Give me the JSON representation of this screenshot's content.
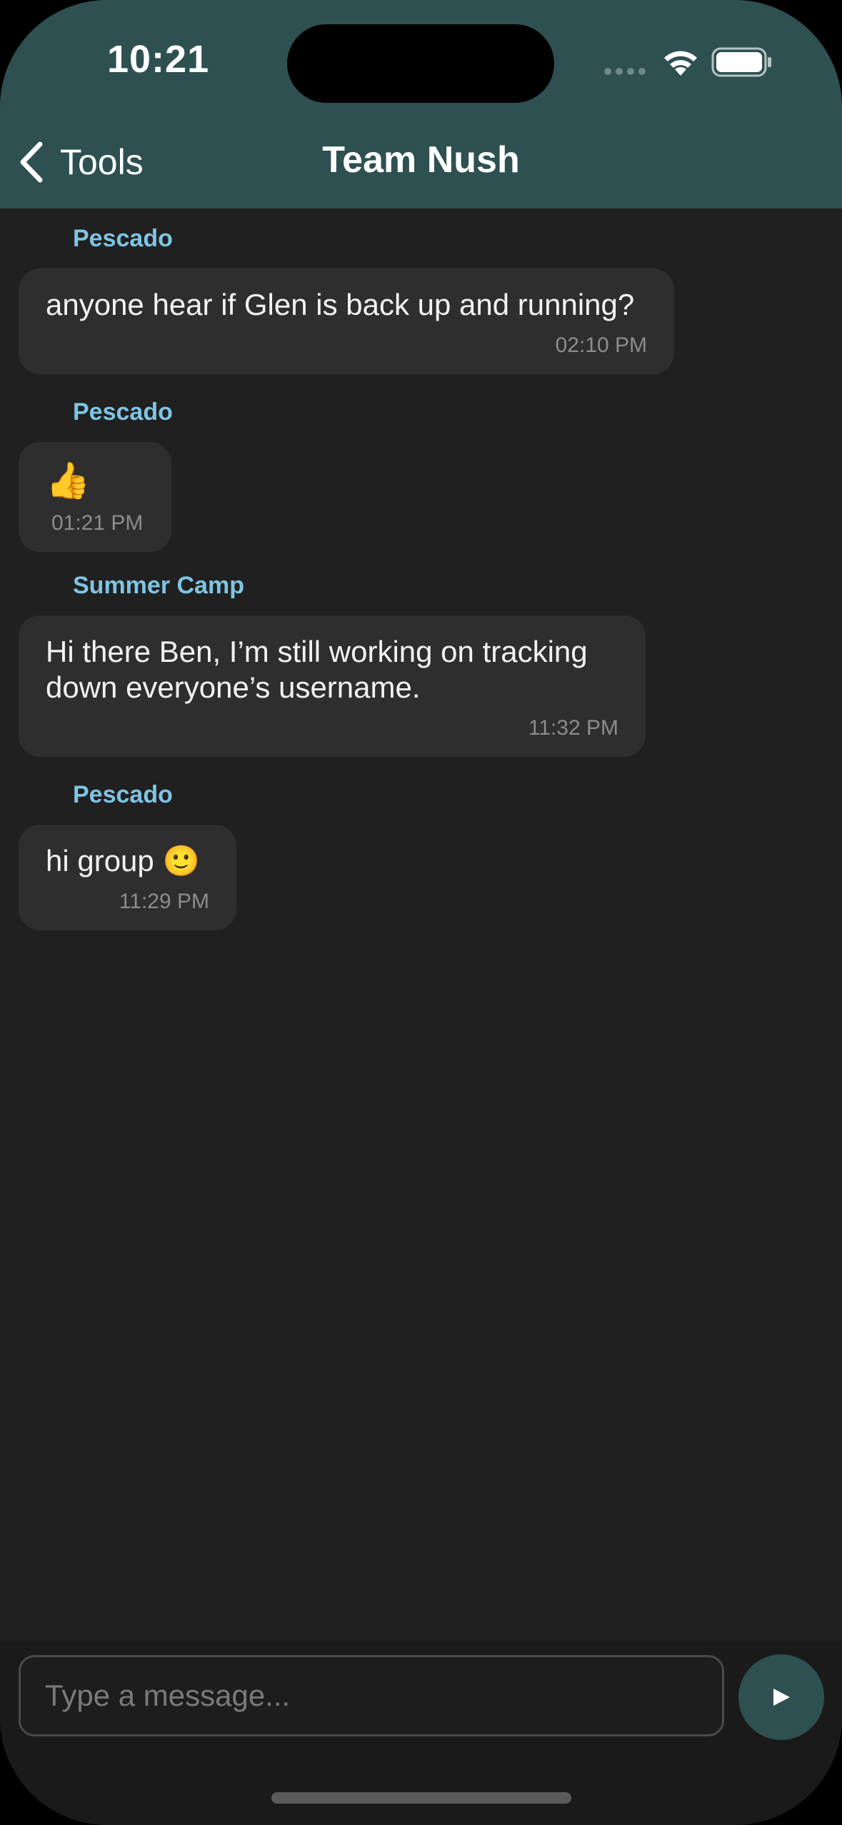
{
  "status": {
    "time": "10:21"
  },
  "nav": {
    "back_label": "Tools",
    "title": "Team Nush"
  },
  "messages": [
    {
      "sender": "Pescado",
      "text": "anyone hear if Glen is back up and running?",
      "time": "02:10 PM"
    },
    {
      "sender": "Pescado",
      "text": "👍",
      "time": "01:21 PM"
    },
    {
      "sender": "Summer Camp",
      "text": "Hi there Ben, I’m still working on tracking\ndown everyone’s username.",
      "time": "11:32 PM"
    },
    {
      "sender": "Pescado",
      "text": "hi group 🙂",
      "time": "11:29 PM"
    }
  ],
  "composer": {
    "placeholder": "Type a message..."
  },
  "colors": {
    "header": "#2e5050",
    "background": "#202020",
    "bubble": "#2e2e2e",
    "sender": "#7fc4e4"
  }
}
